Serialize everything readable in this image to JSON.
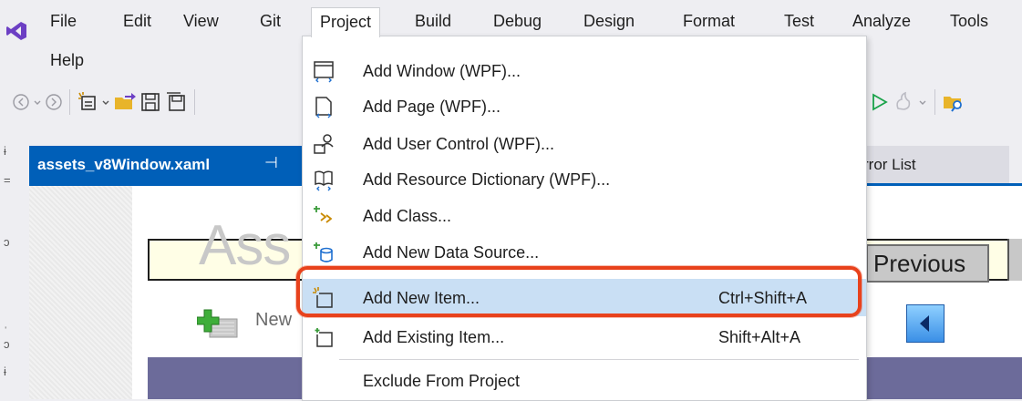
{
  "menubar": {
    "items": [
      "File",
      "Edit",
      "View",
      "Git",
      "Project",
      "Build",
      "Debug",
      "Design",
      "Format",
      "Test",
      "Analyze",
      "Tools",
      "Help"
    ]
  },
  "editor": {
    "tab_label": "assets_v8Window.xaml",
    "tab_pin": "⊣",
    "error_tab_label": "rror List"
  },
  "designer": {
    "assets_ghost": "Ass",
    "previous_label": "Previous",
    "new_label": "New"
  },
  "project_menu": {
    "items": [
      {
        "label": "Add Window (WPF)...",
        "icon": "window-icon"
      },
      {
        "label": "Add Page (WPF)...",
        "icon": "page-icon"
      },
      {
        "label": "Add User Control (WPF)...",
        "icon": "user-control-icon"
      },
      {
        "label": "Add Resource Dictionary (WPF)...",
        "icon": "resource-dictionary-icon"
      },
      {
        "label": "Add Class...",
        "icon": "class-icon"
      },
      {
        "label": "Add New Data Source...",
        "icon": "data-source-icon"
      },
      {
        "label": "Add New Item...",
        "shortcut": "Ctrl+Shift+A",
        "icon": "new-item-icon",
        "highlighted": true
      },
      {
        "label": "Add Existing Item...",
        "shortcut": "Shift+Alt+A",
        "icon": "existing-item-icon"
      },
      {
        "label": "Exclude From Project"
      }
    ]
  },
  "colors": {
    "accent_blue": "#005fb8",
    "highlight_red": "#e8421c",
    "selected_row": "#c9dff4",
    "purple_band": "#6c6b9a"
  }
}
